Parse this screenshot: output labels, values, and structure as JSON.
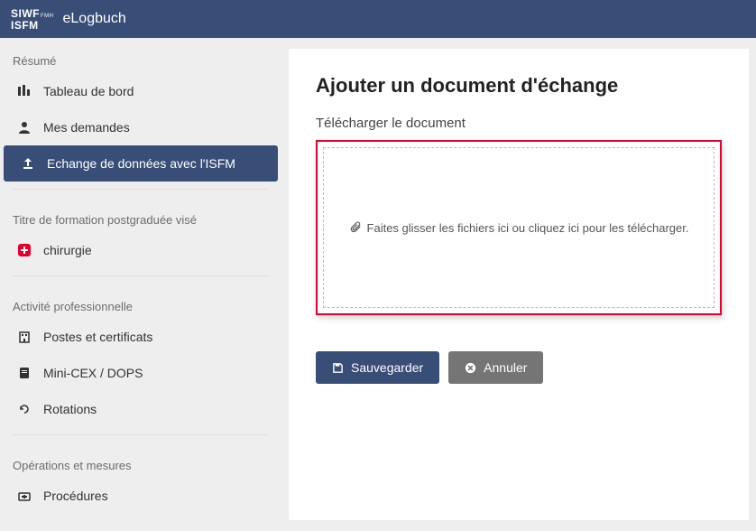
{
  "header": {
    "logo_line1": "SIWF",
    "logo_sub": "FMH",
    "logo_line2": "ISFM",
    "app_title": "eLogbuch"
  },
  "sidebar": {
    "sections": [
      {
        "label": "Résumé",
        "items": [
          {
            "icon": "dashboard-icon",
            "label": "Tableau de bord",
            "active": false
          },
          {
            "icon": "user-icon",
            "label": "Mes demandes",
            "active": false
          },
          {
            "icon": "upload-icon",
            "label": "Echange de données avec l'ISFM",
            "active": true
          }
        ]
      },
      {
        "label": "Titre de formation postgraduée visé",
        "items": [
          {
            "icon": "plus-cross-icon",
            "label": "chirurgie",
            "active": false,
            "special": true
          }
        ]
      },
      {
        "label": "Activité professionnelle",
        "items": [
          {
            "icon": "building-icon",
            "label": "Postes et certificats",
            "active": false
          },
          {
            "icon": "clipboard-icon",
            "label": "Mini-CEX / DOPS",
            "active": false
          },
          {
            "icon": "rotate-icon",
            "label": "Rotations",
            "active": false
          }
        ]
      },
      {
        "label": "Opérations et mesures",
        "items": [
          {
            "icon": "medkit-icon",
            "label": "Procédures",
            "active": false
          }
        ]
      }
    ]
  },
  "main": {
    "title": "Ajouter un document d'échange",
    "upload_label": "Télécharger le document",
    "upload_hint": "Faites glisser les fichiers ici ou cliquez ici pour les télécharger.",
    "save_label": "Sauvegarder",
    "cancel_label": "Annuler"
  },
  "colors": {
    "brand": "#384e77",
    "highlight_border": "#e4002b",
    "secondary_btn": "#757575"
  }
}
